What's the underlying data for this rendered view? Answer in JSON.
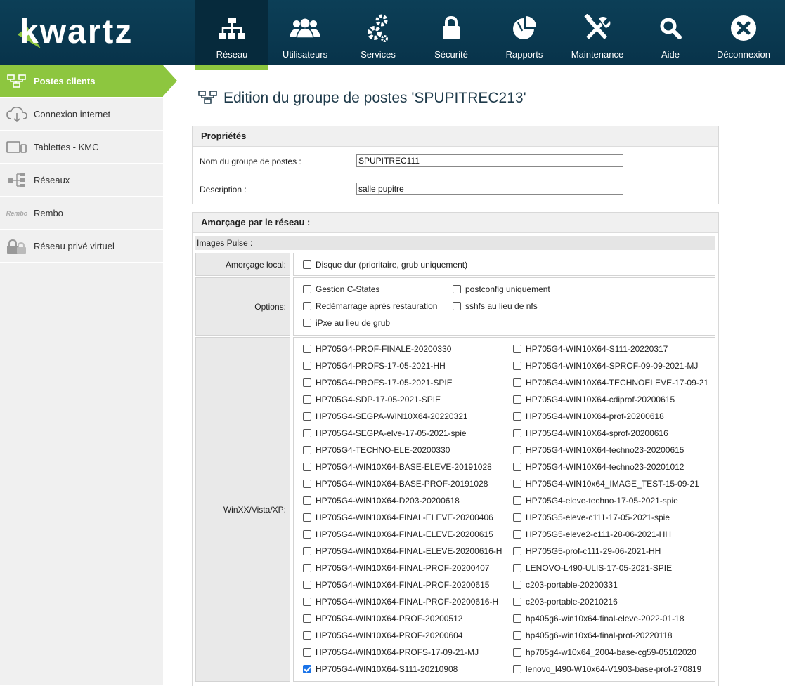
{
  "app": {
    "logo_text": "kwartz"
  },
  "nav": [
    {
      "id": "reseau",
      "label": "Réseau",
      "icon": "network-icon",
      "active": true
    },
    {
      "id": "utilisateurs",
      "label": "Utilisateurs",
      "icon": "users-icon",
      "active": false
    },
    {
      "id": "services",
      "label": "Services",
      "icon": "gears-icon",
      "active": false
    },
    {
      "id": "securite",
      "label": "Sécurité",
      "icon": "lock-icon",
      "active": false
    },
    {
      "id": "rapports",
      "label": "Rapports",
      "icon": "pie-chart-icon",
      "active": false
    },
    {
      "id": "maintenance",
      "label": "Maintenance",
      "icon": "tools-icon",
      "active": false
    },
    {
      "id": "aide",
      "label": "Aide",
      "icon": "search-icon",
      "active": false
    },
    {
      "id": "deconnexion",
      "label": "Déconnexion",
      "icon": "close-icon",
      "active": false
    }
  ],
  "sidebar": [
    {
      "label": "Postes clients",
      "icon": "workstations-icon",
      "active": true
    },
    {
      "label": "Connexion internet",
      "icon": "cloud-icon",
      "active": false
    },
    {
      "label": "Tablettes - KMC",
      "icon": "tablet-icon",
      "active": false
    },
    {
      "label": "Réseaux",
      "icon": "network-tree-icon",
      "active": false
    },
    {
      "label": "Rembo",
      "icon": "rembo-logo-icon",
      "icon_text": "Rembo",
      "active": false
    },
    {
      "label": "Réseau privé virtuel",
      "icon": "vpn-lock-icon",
      "active": false
    }
  ],
  "page": {
    "title": "Edition du groupe de postes 'SPUPITREC213'"
  },
  "properties": {
    "header": "Propriétés",
    "name_label": "Nom du groupe de postes :",
    "name_value": "SPUPITREC111",
    "desc_label": "Description :",
    "desc_value": "salle pupitre"
  },
  "boot": {
    "header": "Amorçage par le réseau :",
    "images_label": "Images Pulse :",
    "local_label": "Amorçage local:",
    "local_option": {
      "label": "Disque dur (prioritaire, grub uniquement)",
      "checked": false
    },
    "options_label": "Options:",
    "options": [
      {
        "label": "Gestion C-States",
        "checked": false
      },
      {
        "label": "postconfig uniquement",
        "checked": false
      },
      {
        "label": "Redémarrage après restauration",
        "checked": false
      },
      {
        "label": "sshfs au lieu de nfs",
        "checked": false
      },
      {
        "label": "iPxe au lieu de grub",
        "checked": false
      }
    ],
    "os_label": "WinXX/Vista/XP:",
    "images_col1": [
      {
        "label": "HP705G4-PROF-FINALE-20200330",
        "checked": false
      },
      {
        "label": "HP705G4-PROFS-17-05-2021-HH",
        "checked": false
      },
      {
        "label": "HP705G4-PROFS-17-05-2021-SPIE",
        "checked": false
      },
      {
        "label": "HP705G4-SDP-17-05-2021-SPIE",
        "checked": false
      },
      {
        "label": "HP705G4-SEGPA-WIN10X64-20220321",
        "checked": false
      },
      {
        "label": "HP705G4-SEGPA-elve-17-05-2021-spie",
        "checked": false
      },
      {
        "label": "HP705G4-TECHNO-ELE-20200330",
        "checked": false
      },
      {
        "label": "HP705G4-WIN10X64-BASE-ELEVE-20191028",
        "checked": false
      },
      {
        "label": "HP705G4-WIN10X64-BASE-PROF-20191028",
        "checked": false
      },
      {
        "label": "HP705G4-WIN10X64-D203-20200618",
        "checked": false
      },
      {
        "label": "HP705G4-WIN10X64-FINAL-ELEVE-20200406",
        "checked": false
      },
      {
        "label": "HP705G4-WIN10X64-FINAL-ELEVE-20200615",
        "checked": false
      },
      {
        "label": "HP705G4-WIN10X64-FINAL-ELEVE-20200616-H",
        "checked": false
      },
      {
        "label": "HP705G4-WIN10X64-FINAL-PROF-20200407",
        "checked": false
      },
      {
        "label": "HP705G4-WIN10X64-FINAL-PROF-20200615",
        "checked": false
      },
      {
        "label": "HP705G4-WIN10X64-FINAL-PROF-20200616-H",
        "checked": false
      },
      {
        "label": "HP705G4-WIN10X64-PROF-20200512",
        "checked": false
      },
      {
        "label": "HP705G4-WIN10X64-PROF-20200604",
        "checked": false
      },
      {
        "label": "HP705G4-WIN10X64-PROFS-17-09-21-MJ",
        "checked": false
      },
      {
        "label": "HP705G4-WIN10X64-S111-20210908",
        "checked": true
      }
    ],
    "images_col2": [
      {
        "label": "HP705G4-WIN10X64-S111-20220317",
        "checked": false
      },
      {
        "label": "HP705G4-WIN10X64-SPROF-09-09-2021-MJ",
        "checked": false
      },
      {
        "label": "HP705G4-WIN10X64-TECHNOELEVE-17-09-21",
        "checked": false
      },
      {
        "label": "HP705G4-WIN10X64-cdiprof-20200615",
        "checked": false
      },
      {
        "label": "HP705G4-WIN10X64-prof-20200618",
        "checked": false
      },
      {
        "label": "HP705G4-WIN10X64-sprof-20200616",
        "checked": false
      },
      {
        "label": "HP705G4-WIN10X64-techno23-20200615",
        "checked": false
      },
      {
        "label": "HP705G4-WIN10X64-techno23-20201012",
        "checked": false
      },
      {
        "label": "HP705G4-WIN10x64_IMAGE_TEST-15-09-21",
        "checked": false
      },
      {
        "label": "HP705G4-eleve-techno-17-05-2021-spie",
        "checked": false
      },
      {
        "label": "HP705G5-eleve-c111-17-05-2021-spie",
        "checked": false
      },
      {
        "label": "HP705G5-eleve2-c111-28-06-2021-HH",
        "checked": false
      },
      {
        "label": "HP705G5-prof-c111-29-06-2021-HH",
        "checked": false
      },
      {
        "label": "LENOVO-L490-ULIS-17-05-2021-SPIE",
        "checked": false
      },
      {
        "label": "c203-portable-20200331",
        "checked": false
      },
      {
        "label": "c203-portable-20210216",
        "checked": false
      },
      {
        "label": "hp405g6-win10x64-final-eleve-2022-01-18",
        "checked": false
      },
      {
        "label": "hp405g6-win10x64-final-prof-20220118",
        "checked": false
      },
      {
        "label": "hp705g4-w10x64_2004-base-cg59-05102020",
        "checked": false
      },
      {
        "label": "lenovo_l490-W10x64-V1903-base-prof-270819",
        "checked": false
      }
    ]
  },
  "colors": {
    "topbar": "#0c3f57",
    "accent": "#8dc63f",
    "sidebar_bg": "#f0f0f0"
  }
}
